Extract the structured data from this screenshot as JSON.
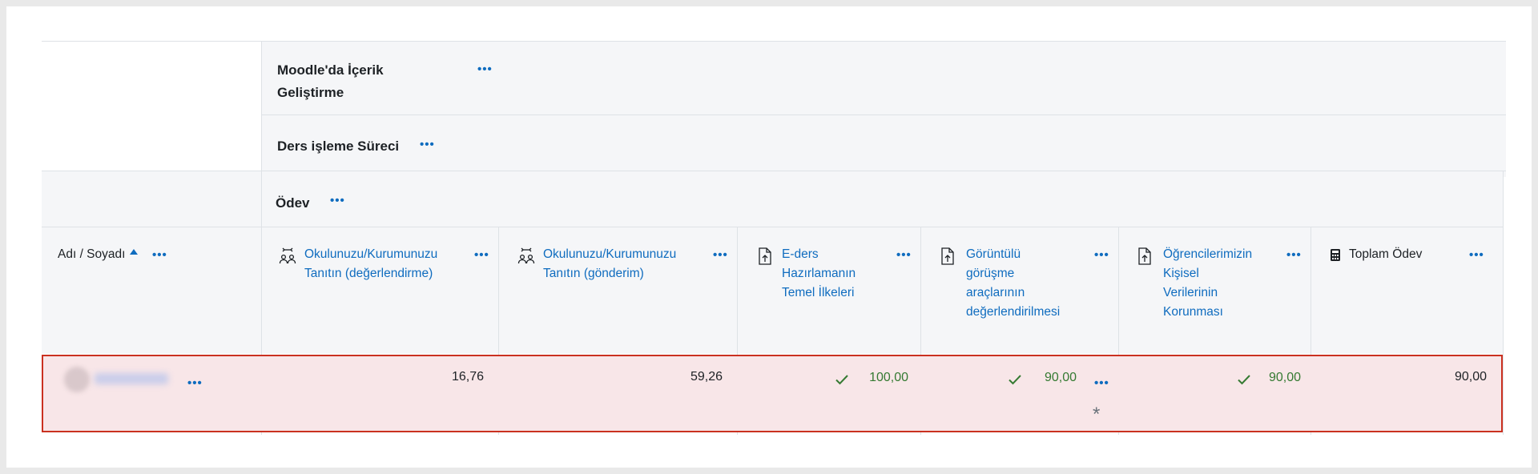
{
  "categories": {
    "top": {
      "label": "Moodle'da İçerik Geliştirme"
    },
    "sub": {
      "label": "Ders işleme Süreci"
    },
    "assign": {
      "label": "Ödev"
    }
  },
  "columns": {
    "name": {
      "label": "Adı / Soyadı"
    },
    "c1": {
      "label_l1": "Okulunuzu/Kurumunuzu",
      "label_l2": "Tanıtın (değerlendirme)",
      "icon": "workshop-icon"
    },
    "c2": {
      "label_l1": "Okulunuzu/Kurumunuzu",
      "label_l2": "Tanıtın (gönderim)",
      "icon": "workshop-icon"
    },
    "c3": {
      "label_l1": "E-ders",
      "label_l2": "Hazırlamanın",
      "label_l3": "Temel İlkeleri",
      "icon": "assignment-upload-icon"
    },
    "c4": {
      "label_l1": "Görüntülü",
      "label_l2": "görüşme",
      "label_l3": "araçlarının",
      "label_l4": "değerlendirilmesi",
      "icon": "assignment-upload-icon"
    },
    "c5": {
      "label_l1": "Öğrencilerimizin",
      "label_l2": "Kişisel",
      "label_l3": "Verilerinin",
      "label_l4": "Korunması",
      "icon": "assignment-upload-icon"
    },
    "total": {
      "label": "Toplam Ödev",
      "icon": "calculator-icon"
    }
  },
  "row": {
    "c1": "16,76",
    "c2": "59,26",
    "c3": "100,00",
    "c4": "90,00",
    "c4_flag": "*",
    "c5": "90,00",
    "total": "90,00"
  },
  "colors": {
    "link": "#0f6cbf",
    "pass": "#357a32",
    "highlight_bg": "#f8e6e8",
    "highlight_border": "#ca3120"
  }
}
